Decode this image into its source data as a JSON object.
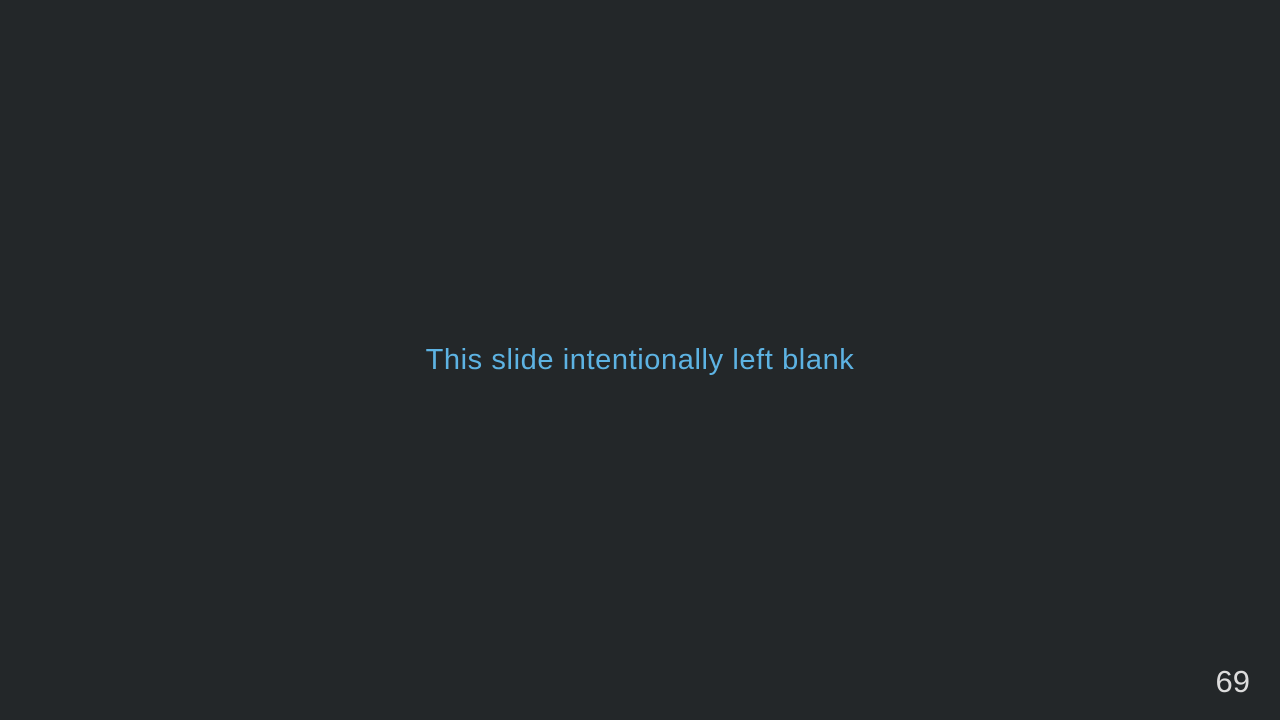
{
  "slide": {
    "message": "This slide intentionally left blank",
    "page_number": "69"
  },
  "colors": {
    "background": "#232729",
    "message_text": "#5db3e3",
    "page_number_text": "#dcdcdc"
  }
}
